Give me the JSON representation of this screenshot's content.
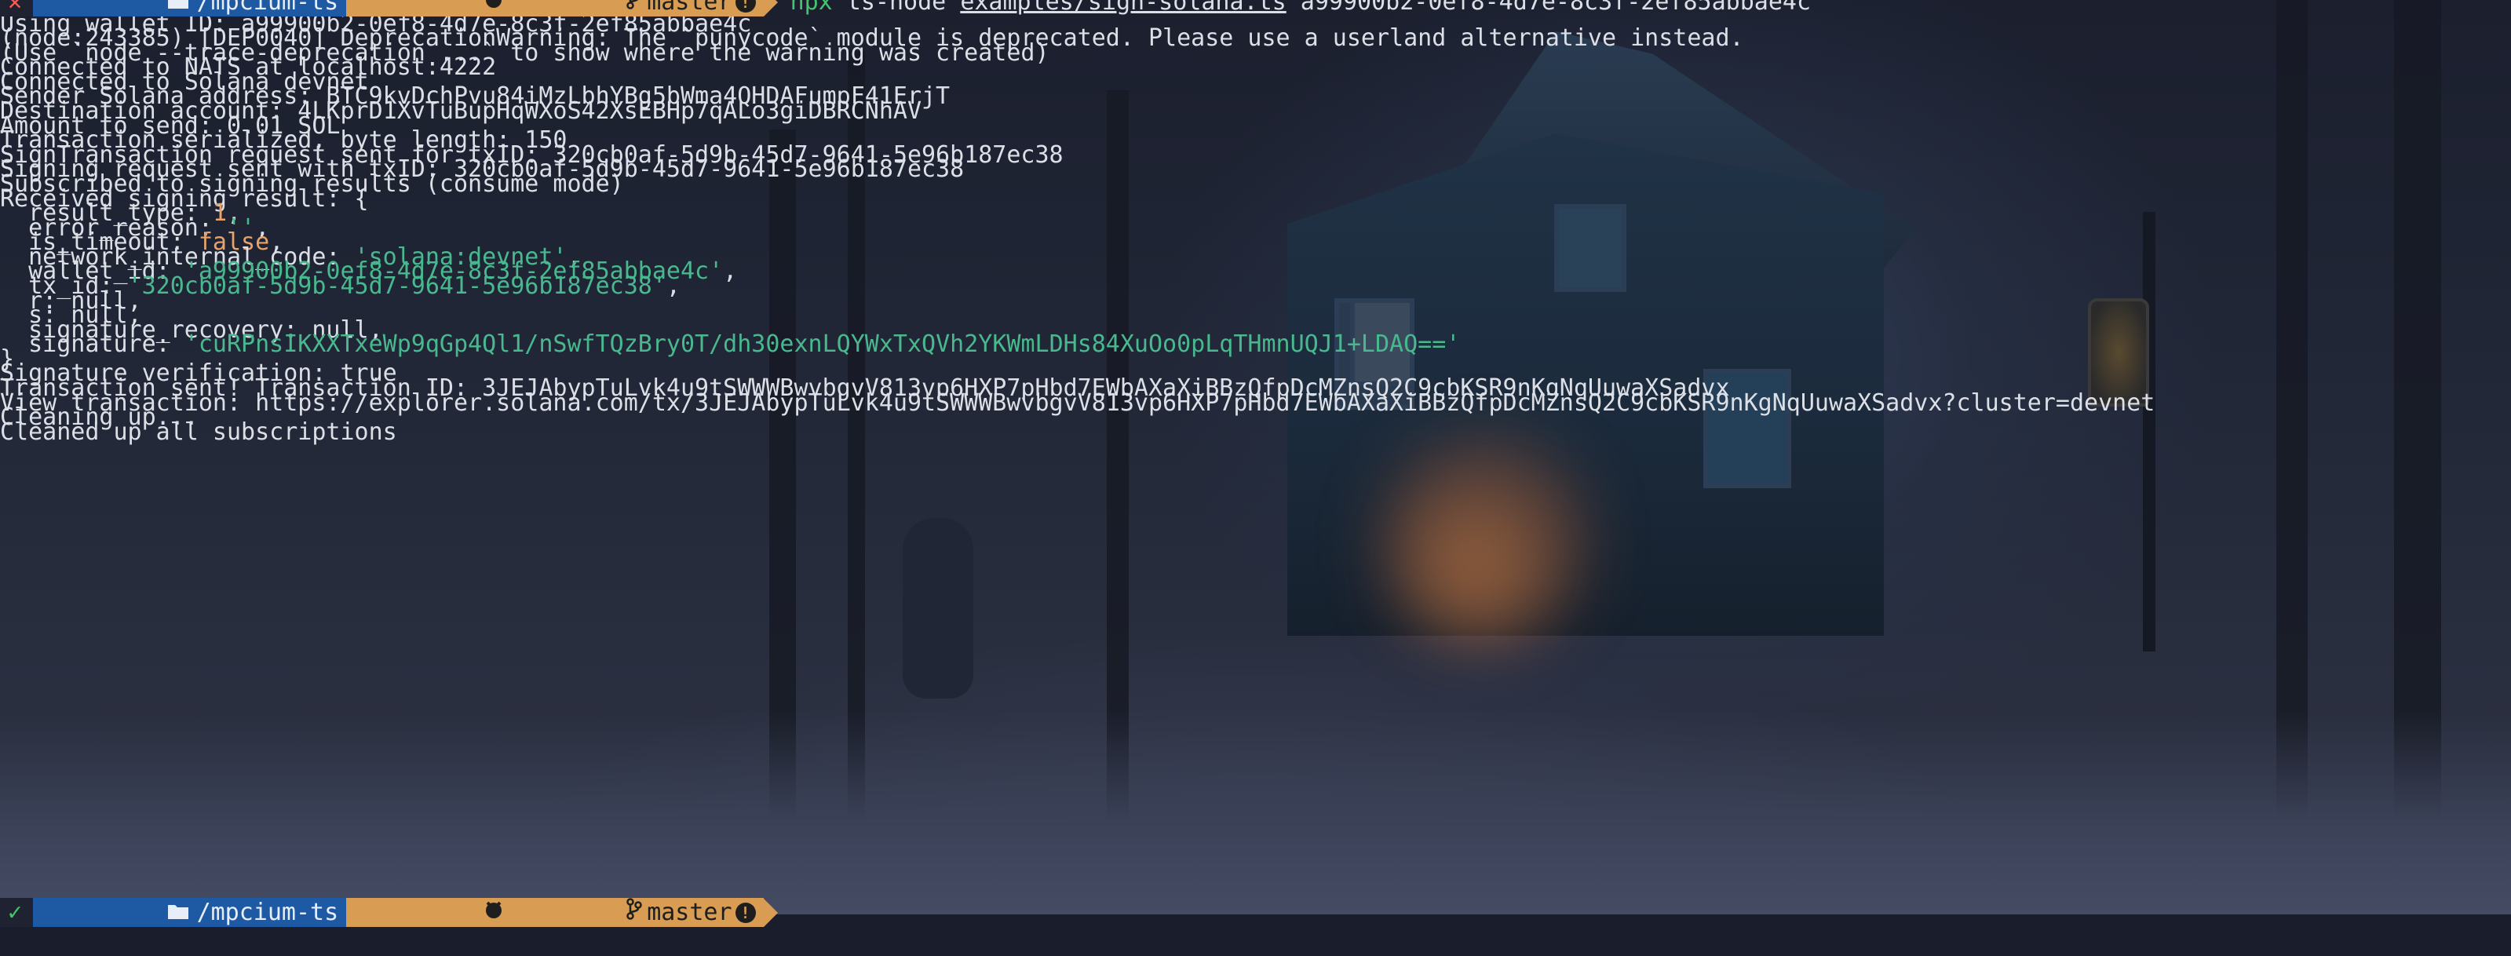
{
  "prompt": {
    "fail_icon": "✕",
    "ok_icon": "✓",
    "folder_icon": "folder-icon",
    "dir": "/mpcium-ts",
    "github_icon": "github-icon",
    "branch_icon": "git-branch-icon",
    "branch": "master",
    "status_icon": "!"
  },
  "command": {
    "program": "npx",
    "runner": " ts-node ",
    "script": "examples/sign-solana.ts",
    "arg": " a99900b2-0ef8-4d7e-8c3f-2ef85abbae4c"
  },
  "output": {
    "l1": "Using wallet ID: a99900b2-0ef8-4d7e-8c3f-2ef85abbae4c",
    "l2": "(node:243385) [DEP0040] DeprecationWarning: The `punycode` module is deprecated. Please use a userland alternative instead.",
    "l3": "(Use `node --trace-deprecation ...` to show where the warning was created)",
    "l4": "Connected to NATS at localhost:4222",
    "l5": "Connected to Solana devnet",
    "l6": "Sender Solana address: BTC9kvDchPvu84iMzLbhYBg5bWma4QHDAFumpF41ErjT",
    "l7": "Destination account: 4LKprD1XvTuBupHqWXoS42XsEBHp7qALo3giDBRCNhAV",
    "l8": "Amount to send: 0.01 SOL",
    "l9": "Transaction serialized, byte length: 150",
    "l10": "SignTransaction request sent for txID: 320cb0af-5d9b-45d7-9641-5e96b187ec38",
    "l11": "Signing request sent with txID: 320cb0af-5d9b-45d7-9641-5e96b187ec38",
    "l12": "Subscribed to signing results (consume mode)",
    "l13": "Received signing result: {",
    "result": {
      "result_type_key": "  result_type: ",
      "result_type_val": "1",
      "error_reason_key": "  error_reason: ",
      "error_reason_val": "''",
      "is_timeout_key": "  is_timeout: ",
      "is_timeout_val": "false",
      "network_key": "  network_internal_code: ",
      "network_val": "'solana:devnet'",
      "wallet_key": "  wallet_id: ",
      "wallet_val": "'a99900b2-0ef8-4d7e-8c3f-2ef85abbae4c'",
      "tx_key": "  tx_id: ",
      "tx_val": "'320cb0af-5d9b-45d7-9641-5e96b187ec38'",
      "r_line": "  r: null,",
      "s_line": "  s: null,",
      "recovery_line": "  signature_recovery: null,",
      "signature_key": "  signature: ",
      "signature_val": "'cuRPnsIKXXTxeWp9qGp4Ql1/nSwfTQzBry0T/dh30exnLQYWxTxQVh2YKWmLDHs84XuOo0pLqTHmnUQJ1+LDAQ=='",
      "comma": ","
    },
    "l24": "}",
    "l25": "Signature verification: true",
    "l26": "Transaction sent! Transaction ID: 3JEJAbypTuLvk4u9tSWWWBwvbgvV813vp6HXP7pHbd7EWbAXaXiBBzQfpDcMZnsQ2C9cbKSR9nKgNqUuwaXSadvx",
    "l27": "View transaction: https://explorer.solana.com/tx/3JEJAbypTuLvk4u9tSWWWBwvbgvV813vp6HXP7pHbd7EWbAXaXiBBzQfpDcMZnsQ2C9cbKSR9nKgNqUuwaXSadvx?cluster=devnet",
    "l28": "Cleaning up...",
    "l29": "Cleaned up all subscriptions"
  },
  "colors": {
    "prompt_dir_bg": "#1d5aa3",
    "prompt_git_bg": "#d89c52",
    "number": "#e8a26a",
    "string": "#49b88f",
    "command": "#46c46d"
  }
}
